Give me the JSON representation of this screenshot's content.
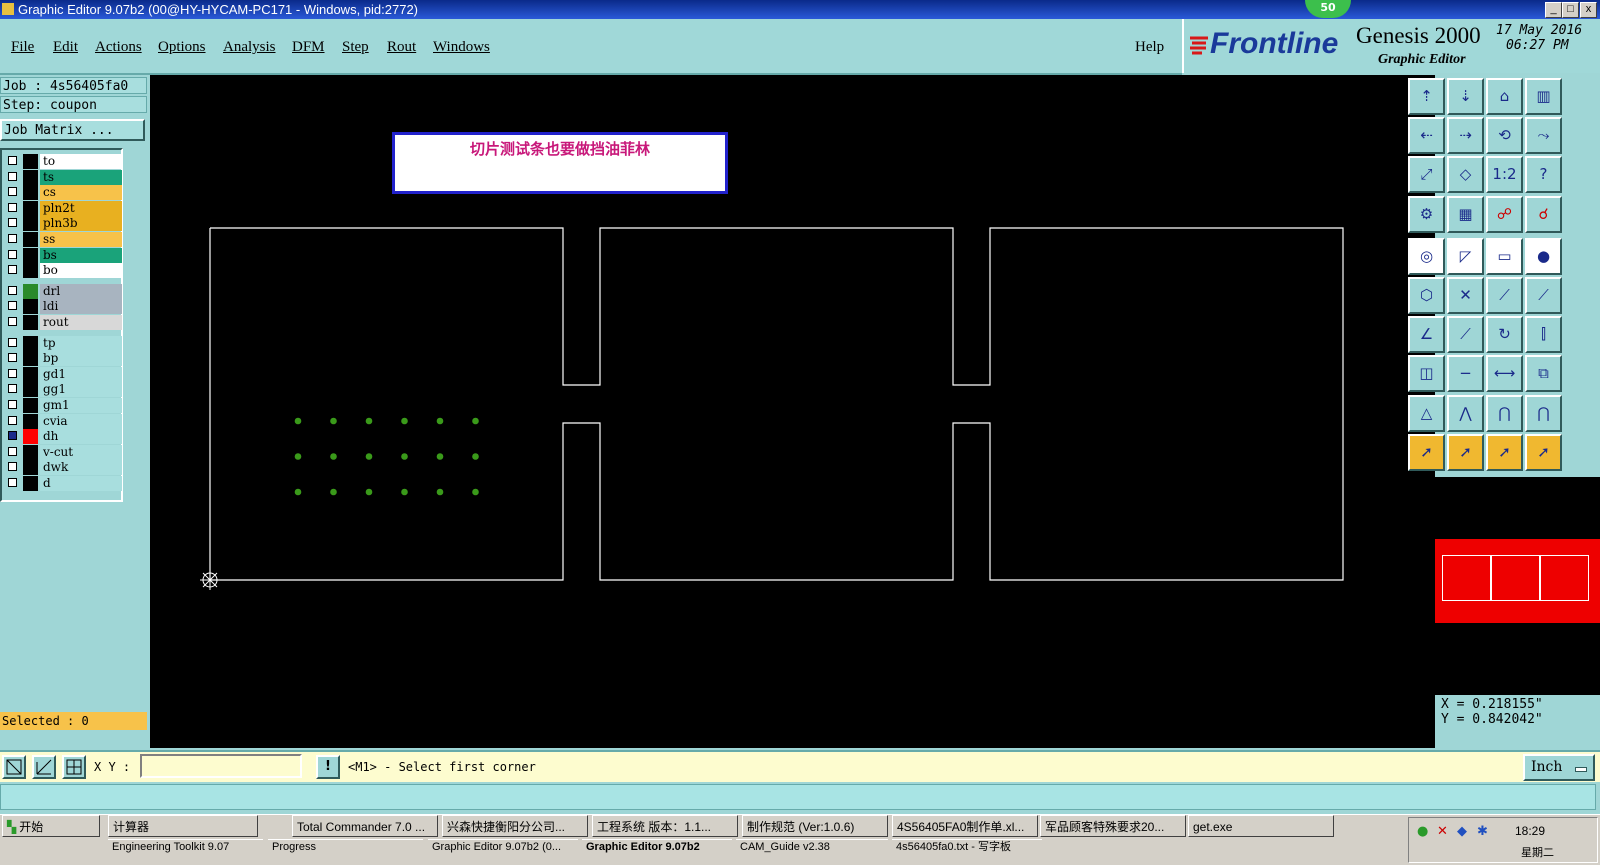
{
  "window": {
    "title": "Graphic Editor 9.07b2 (00@HY-HYCAM-PC171 - Windows, pid:2772)",
    "badge": "50",
    "minimize": "_",
    "maximize": "□",
    "close": "x"
  },
  "menu": {
    "file": "File",
    "edit": "Edit",
    "actions": "Actions",
    "options": "Options",
    "analysis": "Analysis",
    "dfm": "DFM",
    "step": "Step",
    "rout": "Rout",
    "windows": "Windows",
    "help": "Help"
  },
  "brand": {
    "logo": "Frontline",
    "product": "Genesis 2000",
    "subtitle": "Graphic Editor",
    "date": "17 May 2016",
    "time": "06:27 PM"
  },
  "job": {
    "job_label": "Job : 4s56405fa0",
    "step_label": "Step: coupon",
    "matrix_button": "Job Matrix ..."
  },
  "layers": [
    {
      "name": "to",
      "color": "#ffffff",
      "swatch": "#000000"
    },
    {
      "name": "ts",
      "color": "#1aa37a",
      "swatch": "#000000"
    },
    {
      "name": "cs",
      "color": "#f7c24a",
      "swatch": "#000000"
    },
    {
      "name": "pln2t",
      "color": "#e8b020",
      "swatch": "#000000"
    },
    {
      "name": "pln3b",
      "color": "#e8b020",
      "swatch": "#000000"
    },
    {
      "name": "ss",
      "color": "#f7c24a",
      "swatch": "#000000"
    },
    {
      "name": "bs",
      "color": "#1aa37a",
      "swatch": "#000000"
    },
    {
      "name": "bo",
      "color": "#ffffff",
      "swatch": "#000000"
    },
    {
      "name": "drl",
      "color": "#a8b4c0",
      "swatch": "#2a8a2a"
    },
    {
      "name": "ldi",
      "color": "#a8b4c0",
      "swatch": "#000000"
    },
    {
      "name": "rout",
      "color": "#d8d8d8",
      "swatch": "#000000"
    },
    {
      "name": "tp",
      "color": "#a8dede",
      "swatch": "#000000"
    },
    {
      "name": "bp",
      "color": "#a8dede",
      "swatch": "#000000"
    },
    {
      "name": "gd1",
      "color": "#a8dede",
      "swatch": "#000000"
    },
    {
      "name": "gg1",
      "color": "#a8dede",
      "swatch": "#000000"
    },
    {
      "name": "gm1",
      "color": "#a8dede",
      "swatch": "#000000"
    },
    {
      "name": "cvia",
      "color": "#a8dede",
      "swatch": "#000000"
    },
    {
      "name": "dh",
      "color": "#a8dede",
      "swatch": "#ff0000",
      "active": true
    },
    {
      "name": "v-cut",
      "color": "#a8dede",
      "swatch": "#000000"
    },
    {
      "name": "dwk",
      "color": "#a8dede",
      "swatch": "#000000"
    },
    {
      "name": "d",
      "color": "#a8dede",
      "swatch": "#000000"
    }
  ],
  "selected": "Selected : 0",
  "note": "切片测试条也要做挡油菲林",
  "coords": {
    "x": "X = 0.218155\"",
    "y": "Y = 0.842042\""
  },
  "command": {
    "xy_label": "X Y :",
    "xy_value": "",
    "prompt": "<M1> - Select first corner",
    "units": "Inch"
  },
  "taskbar": {
    "start": "开始",
    "row1": [
      "计算器",
      "Total Commander 7.0 ...",
      "兴森快捷衡阳分公司...",
      "工程系统  版本：1.1...",
      "制作规范 (Ver:1.0.6)",
      "4S56405FA0制作单.xl...",
      "军品顾客特殊要求20...",
      "get.exe"
    ],
    "row2": [
      "Engineering Toolkit 9.07",
      "Progress",
      "Graphic Editor 9.07b2 (0...",
      "Graphic Editor 9.07b2",
      "CAM_Guide v2.38",
      "4s56405fa0.txt - 写字板"
    ],
    "clock": "18:29",
    "weekday": "星期二"
  },
  "colors": {
    "canvas": "#000000",
    "outline": "#ffffff",
    "drill": "#3a9a1a",
    "note_text": "#c8187a",
    "note_border": "#2222cc",
    "panel": "#9fd6d6"
  }
}
